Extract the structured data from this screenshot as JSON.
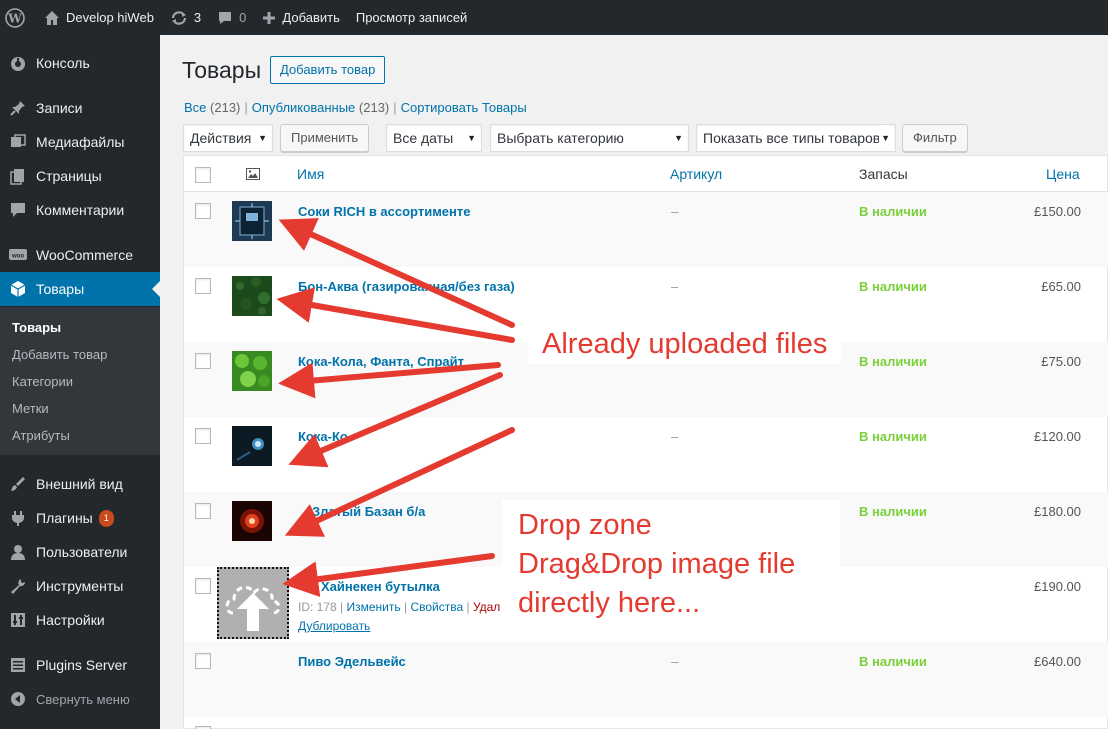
{
  "admin_bar": {
    "site_name": "Develop hiWeb",
    "updates_count": "3",
    "comments_count": "0",
    "add_new": "Добавить",
    "view_posts": "Просмотр записей"
  },
  "sidebar": {
    "items": [
      {
        "label": "Консоль",
        "icon": "dashboard-icon"
      },
      {
        "label": "Записи",
        "icon": "pin-icon"
      },
      {
        "label": "Медиафайлы",
        "icon": "media-icon"
      },
      {
        "label": "Страницы",
        "icon": "pages-icon"
      },
      {
        "label": "Комментарии",
        "icon": "comment-icon"
      },
      {
        "label": "WooCommerce",
        "icon": "woo-icon"
      },
      {
        "label": "Товары",
        "icon": "cube-icon"
      },
      {
        "label": "Внешний вид",
        "icon": "brush-icon"
      },
      {
        "label": "Плагины",
        "icon": "plugin-icon",
        "badge": "1"
      },
      {
        "label": "Пользователи",
        "icon": "user-icon"
      },
      {
        "label": "Инструменты",
        "icon": "wrench-icon"
      },
      {
        "label": "Настройки",
        "icon": "settings-icon"
      },
      {
        "label": "Plugins Server",
        "icon": "server-icon"
      },
      {
        "label": "Свернуть меню",
        "icon": "collapse-icon"
      }
    ],
    "submenu": [
      "Товары",
      "Добавить товар",
      "Категории",
      "Метки",
      "Атрибуты"
    ]
  },
  "page": {
    "title": "Товары",
    "add_button": "Добавить товар",
    "views": {
      "all": "Все",
      "all_count": "(213)",
      "published": "Опубликованные",
      "published_count": "(213)",
      "sort": "Сортировать Товары"
    },
    "filters": {
      "bulk_actions": "Действия",
      "apply": "Применить",
      "dates": "Все даты",
      "category": "Выбрать категорию",
      "product_type": "Показать все типы товаров",
      "filter_button": "Фильтр"
    }
  },
  "table": {
    "columns": {
      "name": "Имя",
      "sku": "Артикул",
      "stock": "Запасы",
      "price": "Цена"
    },
    "rows": [
      {
        "name": "Соки RICH в ассортименте",
        "sku": "–",
        "stock": "В наличии",
        "price": "£150.00"
      },
      {
        "name": "Бон-Аква (газированная/без газа)",
        "sku": "–",
        "stock": "В наличии",
        "price": "£65.00"
      },
      {
        "name": "Кока-Кола, Фанта, Спрайт",
        "sku": "–",
        "stock": "В наличии",
        "price": "£75.00"
      },
      {
        "name": "Кока-Ко",
        "sku": "–",
        "stock": "В наличии",
        "price": "£120.00"
      },
      {
        "name": "Златый Базан б/а",
        "sku": "–",
        "stock": "В наличии",
        "price": "£180.00"
      },
      {
        "name": "Хайнекен бутылка",
        "sku": "",
        "stock": "",
        "price": "£190.00",
        "actions": {
          "id": "ID: 178",
          "edit": "Изменить",
          "props": "Свойства",
          "trash": "Удал",
          "duplicate": "Дублировать"
        }
      },
      {
        "name": "Пиво Эдельвейс",
        "sku": "–",
        "stock": "В наличии",
        "price": "£640.00"
      }
    ]
  },
  "annotations": {
    "uploaded": "Already uploaded files",
    "dropzone_line1": "Drop zone",
    "dropzone_line2": "Drag&Drop image file",
    "dropzone_line3": "directly here..."
  },
  "colors": {
    "admin_dark": "#23282d",
    "accent": "#0073aa",
    "in_stock": "#7ad03a",
    "annotation": "#e53a2f"
  }
}
